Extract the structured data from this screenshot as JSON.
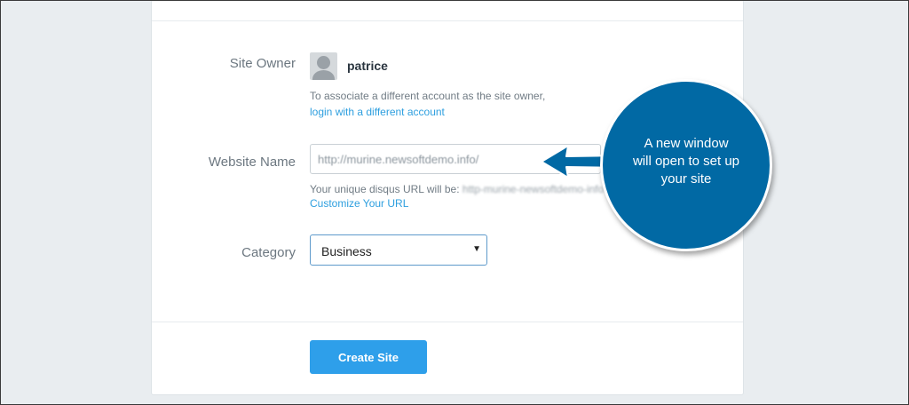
{
  "form": {
    "site_owner_label": "Site Owner",
    "owner_name": "patrice",
    "owner_help": "To associate a different account as the site owner,",
    "owner_link": "login with a different account",
    "website_name_label": "Website Name",
    "website_name_value": "http://murine.newsoftdemo.info/",
    "url_help_prefix": "Your unique disqus URL will be: ",
    "url_help_value": "http-murine-newsoftdemo-info",
    "customize_link": "Customize Your URL",
    "category_label": "Category",
    "category_value": "Business",
    "create_button": "Create Site"
  },
  "callout": {
    "line1": "A new window",
    "line2": "will open to set up",
    "line3": "your site"
  },
  "colors": {
    "accent": "#2e9fea",
    "link": "#2e9fdf",
    "callout": "#0169a4",
    "background": "#e9edf0"
  },
  "icons": {
    "avatar": "default-user-avatar",
    "caret": "caret-down-icon",
    "arrow": "left-arrow-icon"
  }
}
